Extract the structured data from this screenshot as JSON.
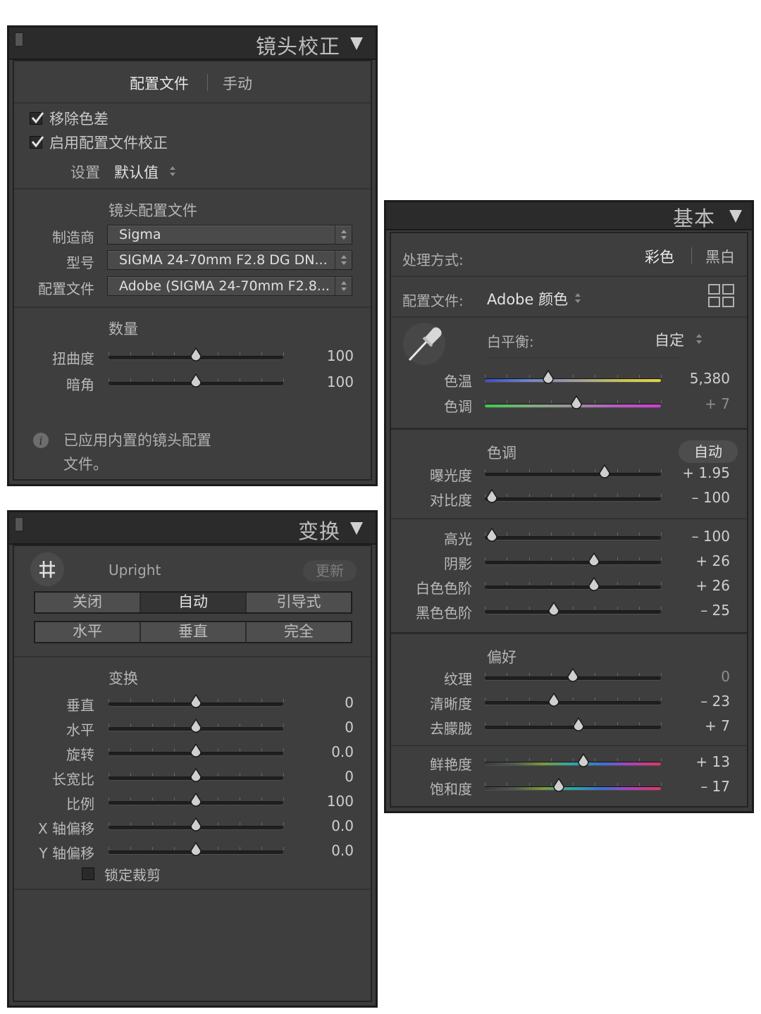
{
  "lens_panel": {
    "title": "镜头校正",
    "tabs": [
      "配置文件",
      "手动"
    ],
    "remove_ca": "移除色差",
    "enable_profile": "启用配置文件校正",
    "setup_label": "设置",
    "setup_value": "默认值",
    "profile_section": "镜头配置文件",
    "make_label": "制造商",
    "make_value": "Sigma",
    "model_label": "型号",
    "model_value": "SIGMA 24-70mm F2.8 DG DN...",
    "profile_label": "配置文件",
    "profile_value": "Adobe (SIGMA 24-70mm F2.8...",
    "amount_section": "数量",
    "sliders": [
      {
        "label": "扭曲度",
        "value": "100",
        "pos": 0.5
      },
      {
        "label": "暗角",
        "value": "100",
        "pos": 0.5
      }
    ],
    "info_line1": "已应用内置的镜头配置",
    "info_line2": "文件。"
  },
  "transform_panel": {
    "title": "变换",
    "upright_label": "Upright",
    "update_label": "更新",
    "row1": [
      "关闭",
      "自动",
      "引导式"
    ],
    "row2": [
      "水平",
      "垂直",
      "完全"
    ],
    "section": "变换",
    "sliders": [
      {
        "label": "垂直",
        "value": "0",
        "pos": 0.5
      },
      {
        "label": "水平",
        "value": "0",
        "pos": 0.5
      },
      {
        "label": "旋转",
        "value": "0.0",
        "pos": 0.5
      },
      {
        "label": "长宽比",
        "value": "0",
        "pos": 0.5
      },
      {
        "label": "比例",
        "value": "100",
        "pos": 0.5
      },
      {
        "label": "X 轴偏移",
        "value": "0.0",
        "pos": 0.5
      },
      {
        "label": "Y 轴偏移",
        "value": "0.0",
        "pos": 0.5
      }
    ],
    "lock_crop": "锁定裁剪"
  },
  "basic_panel": {
    "title": "基本",
    "treatment_label": "处理方式:",
    "treatment_color": "彩色",
    "treatment_bw": "黑白",
    "profile_label": "配置文件:",
    "profile_value": "Adobe 颜色",
    "wb_label": "白平衡:",
    "wb_value": "自定",
    "wb_sliders": [
      {
        "label": "色温",
        "value": "5,380",
        "pos": 0.36,
        "dim": false,
        "track": "temp"
      },
      {
        "label": "色调",
        "value": "+ 7",
        "pos": 0.52,
        "dim": true,
        "track": "tint"
      }
    ],
    "tone_label": "色调",
    "auto_label": "自动",
    "tone_sliders": [
      {
        "label": "曝光度",
        "value": "+ 1.95",
        "pos": 0.68,
        "dim": false
      },
      {
        "label": "对比度",
        "value": "– 100",
        "pos": 0.04,
        "dim": false
      }
    ],
    "tone_sliders2": [
      {
        "label": "高光",
        "value": "– 100",
        "pos": 0.04,
        "dim": false
      },
      {
        "label": "阴影",
        "value": "+ 26",
        "pos": 0.62,
        "dim": false
      },
      {
        "label": "白色色阶",
        "value": "+ 26",
        "pos": 0.62,
        "dim": false
      },
      {
        "label": "黑色色阶",
        "value": "– 25",
        "pos": 0.39,
        "dim": false
      }
    ],
    "presence_label": "偏好",
    "presence_sliders": [
      {
        "label": "纹理",
        "value": "0",
        "pos": 0.5,
        "dim": true
      },
      {
        "label": "清晰度",
        "value": "– 23",
        "pos": 0.39,
        "dim": false
      },
      {
        "label": "去朦胧",
        "value": "+ 7",
        "pos": 0.53,
        "dim": false
      }
    ],
    "color_sliders": [
      {
        "label": "鲜艳度",
        "value": "+ 13",
        "pos": 0.56,
        "dim": false,
        "track": "rainbow"
      },
      {
        "label": "饱和度",
        "value": "– 17",
        "pos": 0.42,
        "dim": false,
        "track": "rainbow"
      }
    ]
  },
  "colors": {
    "panel_bg": "#3e3e3e",
    "header_bg": "#2b2b2b",
    "text": "#c8c8c8"
  }
}
